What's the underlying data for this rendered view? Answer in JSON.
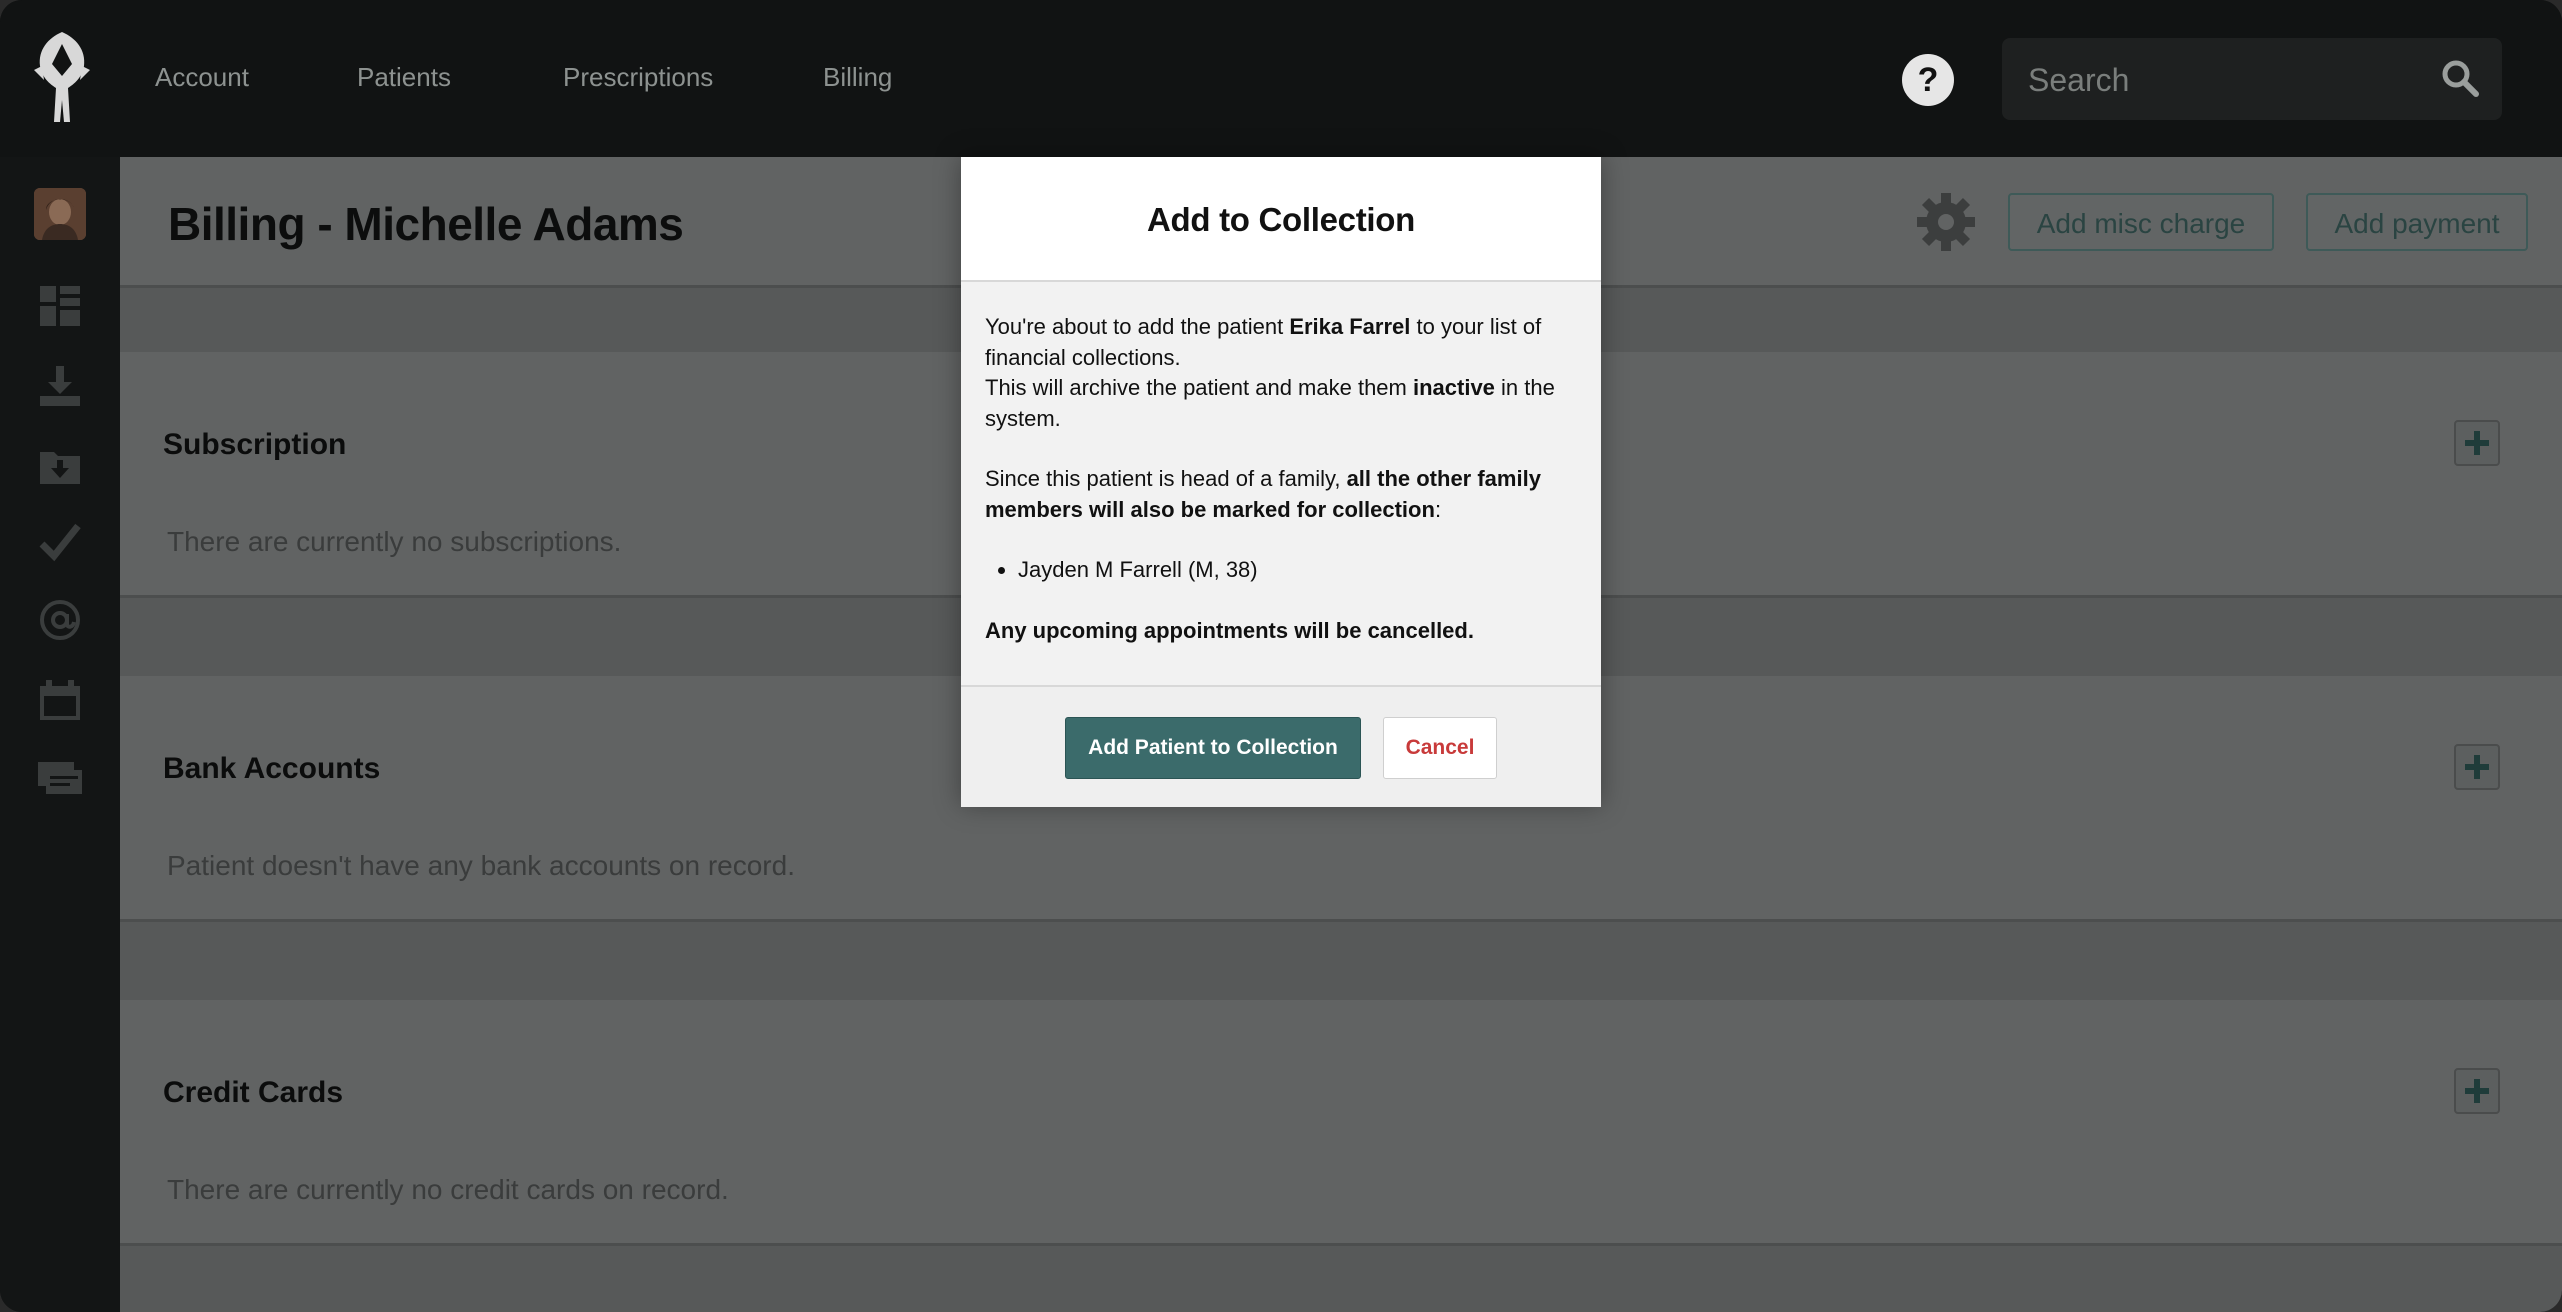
{
  "nav": {
    "items": [
      "Account",
      "Patients",
      "Prescriptions",
      "Billing"
    ],
    "help_label": "?",
    "search_placeholder": "Search"
  },
  "sidebar": {
    "icons": [
      "avatar",
      "dashboard-icon",
      "download-icon",
      "folder-download-icon",
      "checkmark-icon",
      "at-sign-icon",
      "calendar-icon",
      "cards-icon"
    ]
  },
  "page": {
    "title": "Billing - Michelle Adams",
    "add_misc_charge": "Add misc charge",
    "add_payment": "Add payment"
  },
  "sections": [
    {
      "title": "Subscription",
      "text": "There are currently no subscriptions."
    },
    {
      "title": "Bank Accounts",
      "text": "Patient doesn't have any bank accounts on record."
    },
    {
      "title": "Credit Cards",
      "text": "There are currently no credit cards on record."
    }
  ],
  "modal": {
    "title": "Add to Collection",
    "p1_a": "You're about to add the patient ",
    "p1_name": "Erika Farrel",
    "p1_b": " to your list of financial collections.",
    "p2_a": "This will archive the patient and make them ",
    "p2_bold": "inactive",
    "p2_b": " in the system.",
    "p3_a": "Since this patient is head of a family, ",
    "p3_bold": "all the other family members will also be marked for collection",
    "p3_b": ":",
    "members": [
      "Jayden M Farrell (M, 38)"
    ],
    "warning": "Any upcoming appointments will be cancelled.",
    "confirm_label": "Add Patient to Collection",
    "cancel_label": "Cancel"
  },
  "colors": {
    "accent": "#3b6b6b",
    "cancel": "#c83a3a",
    "overlay_bg": "#575959"
  }
}
